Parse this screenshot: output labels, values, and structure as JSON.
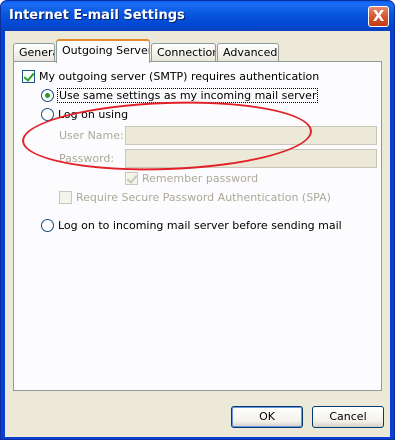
{
  "window": {
    "title": "Internet E-mail Settings",
    "close_glyph": "X"
  },
  "tabs": [
    {
      "label": "General",
      "active": false
    },
    {
      "label": "Outgoing Server",
      "active": true
    },
    {
      "label": "Connection",
      "active": false
    },
    {
      "label": "Advanced",
      "active": false
    }
  ],
  "outgoing": {
    "requires_auth": {
      "label": "My outgoing server (SMTP) requires authentication",
      "checked": true
    },
    "same_settings": {
      "label": "Use same settings as my incoming mail server",
      "selected": true
    },
    "log_on_using": {
      "label": "Log on using",
      "selected": false
    },
    "user_name": {
      "label": "User Name:",
      "value": ""
    },
    "password": {
      "label": "Password:",
      "value": ""
    },
    "remember_password": {
      "label": "Remember password",
      "checked": true
    },
    "require_spa": {
      "label": "Require Secure Password Authentication (SPA)",
      "checked": false
    },
    "log_on_incoming": {
      "label": "Log on to incoming mail server before sending mail",
      "selected": false
    }
  },
  "buttons": {
    "ok": "OK",
    "cancel": "Cancel"
  },
  "colors": {
    "accent": "#21a121",
    "annotation": "#e22027",
    "titlebar": "#0a5ef6"
  }
}
